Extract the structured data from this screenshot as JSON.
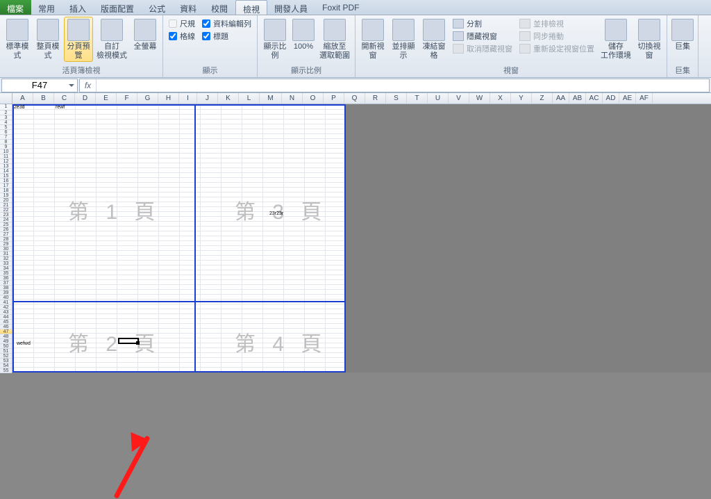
{
  "tabs": {
    "file": "檔案",
    "items": [
      "常用",
      "插入",
      "版面配置",
      "公式",
      "資料",
      "校閱",
      "檢視",
      "開發人員",
      "Foxit PDF"
    ],
    "active_index": 6
  },
  "ribbon": {
    "views": {
      "normal": "標準模式",
      "page_layout": "整頁模式",
      "page_break": "分頁預覽",
      "custom": "自訂\n檢視模式",
      "fullscreen": "全螢幕",
      "group_label": "活頁簿檢視"
    },
    "show": {
      "ruler": "尺規",
      "formula_bar": "資料編輯列",
      "gridlines": "格線",
      "headings": "標題",
      "group_label": "顯示"
    },
    "zoom": {
      "zoom": "顯示比例",
      "hundred": "100%",
      "to_selection": "縮放至\n選取範圍",
      "group_label": "顯示比例"
    },
    "window": {
      "new_window": "開新視窗",
      "arrange": "並排顯示",
      "freeze": "凍結窗格",
      "split": "分割",
      "hide": "隱藏視窗",
      "unhide": "取消隱藏視窗",
      "side_by_side": "並排檢視",
      "sync_scroll": "同步捲動",
      "reset_pos": "重新設定視窗位置",
      "save_workspace": "儲存\n工作環境",
      "switch": "切換視窗",
      "group_label": "視窗"
    },
    "macros": {
      "macros": "巨集",
      "group_label": "巨集"
    }
  },
  "namebox": "F47",
  "fx_label": "fx",
  "columns": [
    "A",
    "B",
    "C",
    "D",
    "E",
    "F",
    "G",
    "H",
    "I",
    "J",
    "K",
    "L",
    "M",
    "N",
    "O",
    "P",
    "Q",
    "R",
    "S",
    "T",
    "U",
    "V",
    "W",
    "X",
    "Y",
    "Z",
    "AA",
    "AB",
    "AC",
    "AD",
    "AE",
    "AF"
  ],
  "cells": {
    "a1": "2e3d",
    "c1": "rewf",
    "m28": "23r23r",
    "b48": "wefwd"
  },
  "page_watermarks": {
    "p1": "第 1 頁",
    "p2": "第 2 頁",
    "p3": "第 3 頁",
    "p4": "第 4 頁"
  },
  "checks": {
    "ruler": false,
    "formula_bar": true,
    "gridlines": true,
    "headings": true
  }
}
